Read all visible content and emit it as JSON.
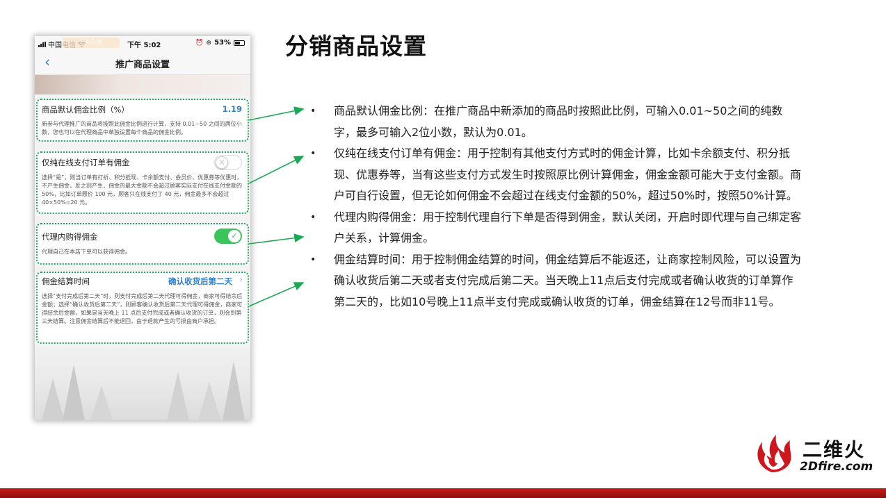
{
  "slide": {
    "title": "分销商品设置"
  },
  "phone": {
    "status_bar": {
      "carrier": "中国电信",
      "live_badge": "E NOW",
      "time": "下午 5:02",
      "battery": "53%"
    },
    "nav": {
      "back_icon": "chevron-left-icon",
      "title": "推广商品设置"
    },
    "cards": [
      {
        "title": "商品默认佣金比例（%）",
        "value": "1.19",
        "desc": "新参与代理推广的商品将按照此佣金比例进行计算，支持 0.01~50 之间的两位小数，您也可以在代理商品中单独设置每个商品的佣金比例。"
      },
      {
        "title": "仅纯在线支付订单有佣金",
        "toggle": "off",
        "desc": "选择“是”，则当订单有打折、积分抵现、卡余额支付、会员价、优惠券等优惠时，不产生佣金，反之则产生，佣金的最大金额不会超过顾客实际支付在线支付金额的 50%，比如订单原价 100 元，顾客只在线支付了 40 元，佣金最多不会超过 40×50%=20 元。"
      },
      {
        "title": "代理内购得佣金",
        "toggle": "on",
        "desc": "代理自己在本店下单可以获得佣金。"
      },
      {
        "title": "佣金结算时间",
        "value": "确认收货后第二天",
        "desc": "选择“支付完成后第二天”时，则支付完成后第二天代理可得佣金，商家可得结余后金额；选择“确认收货后第二天”，则顾客确认收货后第二天代理可得佣金，商家可得结余后金额，如果是当天晚上 11 点后支付完成或者确认收货的订单，则会到第三天结算。注意佣金结算后不能退回，由于退款产生的亏损由商户承担。"
      }
    ]
  },
  "bullets": [
    "商品默认佣金比例：在推广商品中新添加的商品时按照此比例，可输入0.01~50之间的纯数字，最多可输入2位小数，默认为0.01。",
    "仅纯在线支付订单有佣金：用于控制有其他支付方式时的佣金计算，比如卡余额支付、积分抵现、优惠券等，当有这些支付方式发生时按照原比例计算佣金，佣金金额可能大于支付金额。商户可自行设置，但无论如何佣金不会超过在线支付金额的50%，超过50%时，按照50%计算。",
    "代理内购得佣金：用于控制代理自行下单是否得到佣金，默认关闭，开启时即代理与自己绑定客户关系，计算佣金。",
    "佣金结算时间：用于控制佣金结算的时间，佣金结算后不能返还，让商家控制风险，可以设置为确认收货后第二天或者支付完成后第二天。当天晚上11点后支付完成或者确认收货的订单算作第二天的，比如10号晚上11点半支付完成或确认收货的订单，佣金结算在12号而非11号。"
  ],
  "bullet_marker": "•",
  "logo": {
    "cn": "二维火",
    "en": "2Dfire.com"
  },
  "colors": {
    "accent_blue": "#2f80d1",
    "annotation_green": "#1aaa55",
    "toggle_on": "#3ac45a",
    "brand_red": "#c81b1b"
  }
}
